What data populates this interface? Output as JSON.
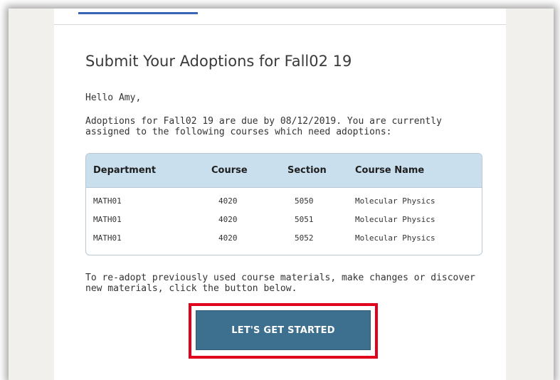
{
  "email": {
    "heading": "Submit Your Adoptions for Fall02 19",
    "greeting": "Hello Amy,",
    "intro": "Adoptions for Fall02 19 are due by 08/12/2019. You are currently assigned to the following courses which need adoptions:",
    "outro": "To re-adopt previously used course materials, make changes or discover new materials, click the button below.",
    "cta_label": "LET'S GET STARTED"
  },
  "table": {
    "headers": [
      "Department",
      "Course",
      "Section",
      "Course Name"
    ],
    "rows": [
      [
        "MATH01",
        "4020",
        "5050",
        "Molecular Physics"
      ],
      [
        "MATH01",
        "4020",
        "5051",
        "Molecular Physics"
      ],
      [
        "MATH01",
        "4020",
        "5052",
        "Molecular Physics"
      ]
    ]
  },
  "colors": {
    "header_bg": "#c9dfee",
    "button_bg": "#3d6f8e",
    "highlight": "#e0001b",
    "link_bar": "#3b63b8"
  }
}
